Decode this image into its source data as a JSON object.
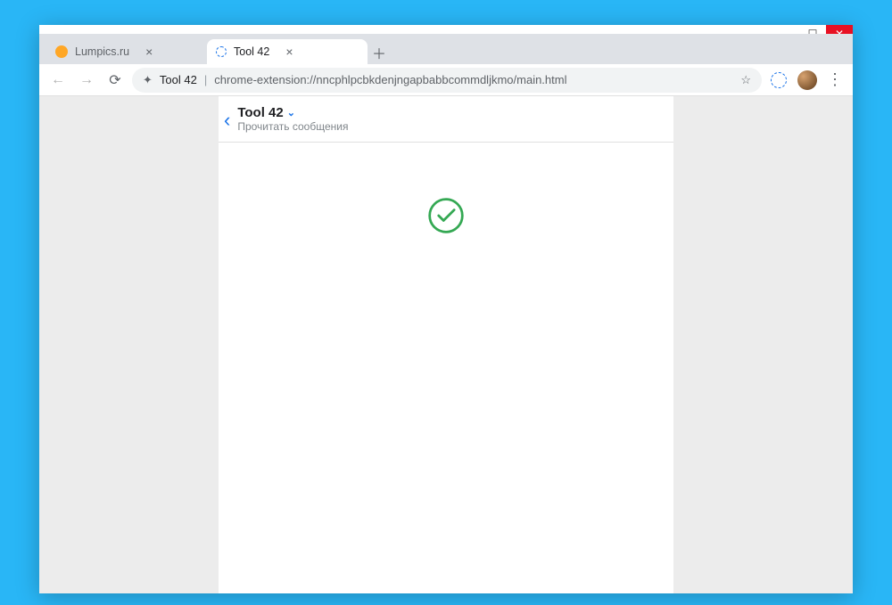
{
  "window_controls": {
    "min": "—",
    "max": "☐",
    "close": "✕"
  },
  "tabs": [
    {
      "title": "Lumpics.ru",
      "active": false
    },
    {
      "title": "Tool 42",
      "active": true
    }
  ],
  "newtab_glyph": "＋",
  "nav": {
    "back": "←",
    "forward": "→",
    "reload": "⟳"
  },
  "address": {
    "ext_glyph": "✦",
    "label": "Tool 42",
    "separator": "|",
    "url": "chrome-extension://nncphlpcbkdenjngapbabbcommdljkmo/main.html",
    "star": "☆"
  },
  "menu_glyph": "⋮",
  "page": {
    "back_glyph": "‹",
    "title": "Tool 42",
    "dropdown_glyph": "⌄",
    "subtitle": "Прочитать сообщения"
  },
  "colors": {
    "accent": "#1a73e8",
    "success": "#34a853"
  }
}
